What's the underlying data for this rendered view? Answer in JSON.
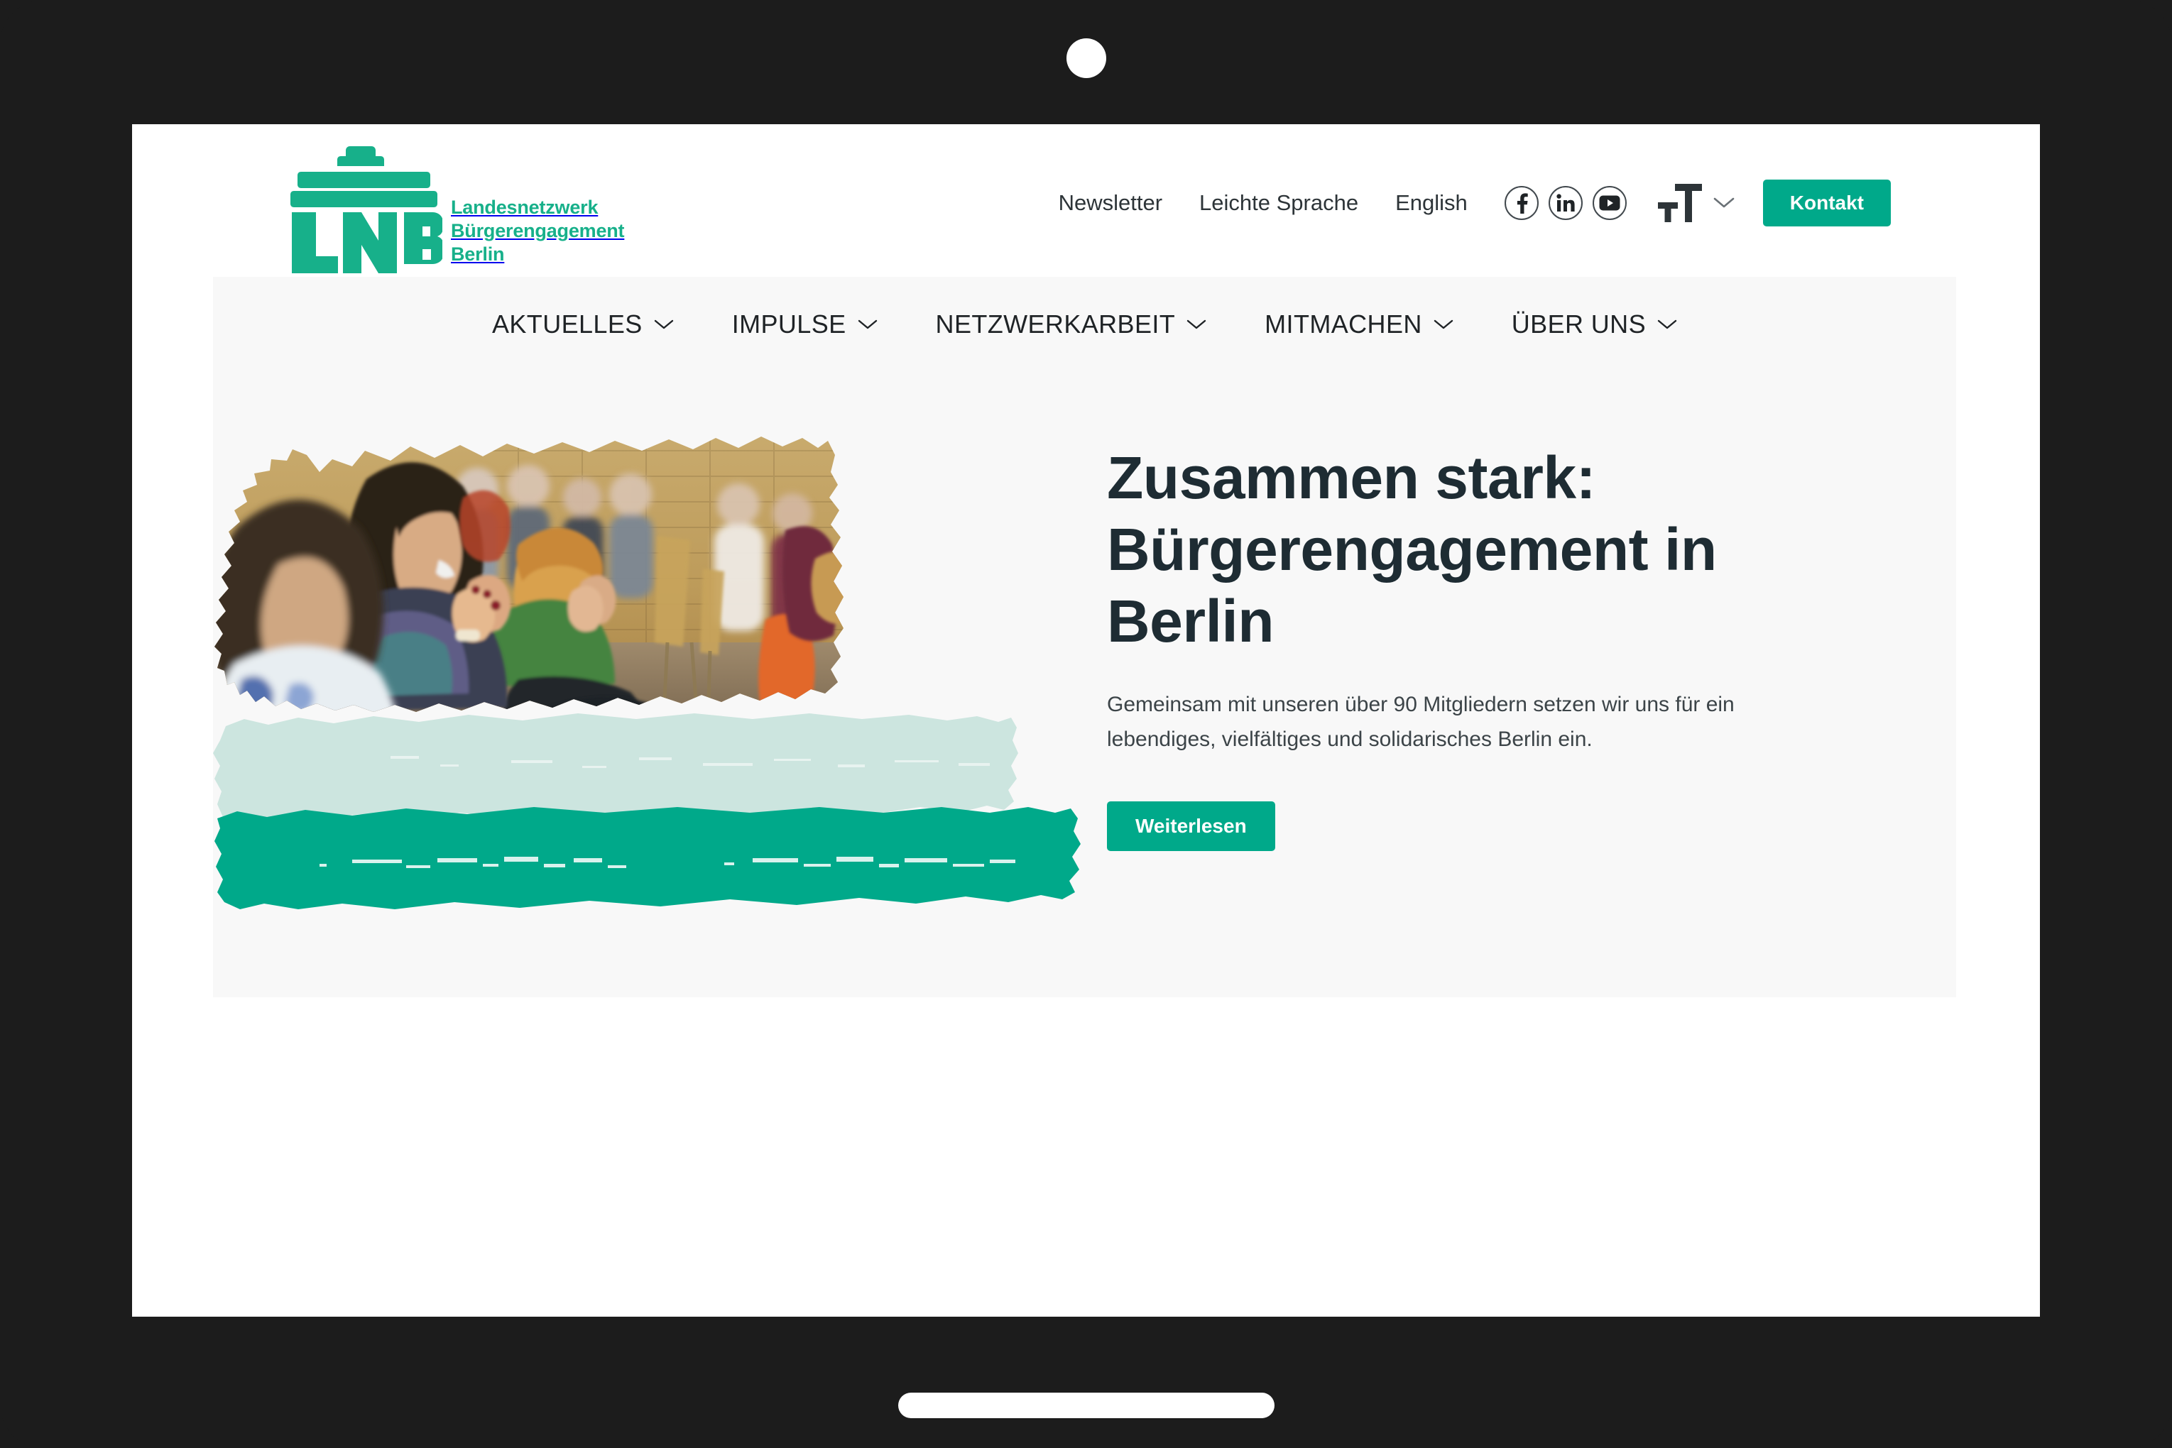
{
  "device": {
    "camera_icon": "camera-dot",
    "home_indicator": "home-indicator-bar"
  },
  "brand": {
    "logo_abbr": "LNBE",
    "logo_icon": "brandenburg-gate-icon",
    "tagline_line1": "Landesnetzwerk",
    "tagline_line2": "Bürgerengagement",
    "tagline_line3": "Berlin",
    "green": "#00A98A",
    "logo_green": "#17B08A"
  },
  "utility_bar": {
    "links": [
      {
        "label": "Newsletter"
      },
      {
        "label": "Leichte Sprache"
      },
      {
        "label": "English"
      }
    ],
    "social": [
      {
        "name": "facebook-icon",
        "glyph": "f"
      },
      {
        "name": "linkedin-icon",
        "glyph": "in"
      },
      {
        "name": "youtube-icon",
        "glyph": "▶"
      }
    ],
    "font_size_control": {
      "icon": "text-size-icon",
      "small_t": "T",
      "large_t": "T",
      "chevron": "chevron-down-icon"
    },
    "contact_button": "Kontakt"
  },
  "main_nav": {
    "items": [
      {
        "label": "AKTUELLES",
        "chevron": "chevron-down-icon"
      },
      {
        "label": "IMPULSE",
        "chevron": "chevron-down-icon"
      },
      {
        "label": "NETZWERKARBEIT",
        "chevron": "chevron-down-icon"
      },
      {
        "label": "MITMACHEN",
        "chevron": "chevron-down-icon"
      },
      {
        "label": "ÜBER UNS",
        "chevron": "chevron-down-icon"
      }
    ]
  },
  "hero": {
    "image_alt": "applauding-audience-photo",
    "brush_mint": "#cce5df",
    "brush_green": "#00A98A",
    "title": "Zusammen stark: Bürgerengagement in Berlin",
    "paragraph": "Gemeinsam mit unseren über 90 Mitgliedern setzen wir uns für ein lebendiges, vielfältiges und solidarisches Berlin ein.",
    "cta_label": "Weiterlesen",
    "heading_color": "#1e2c33",
    "panel_background": "#f8f8f8"
  }
}
